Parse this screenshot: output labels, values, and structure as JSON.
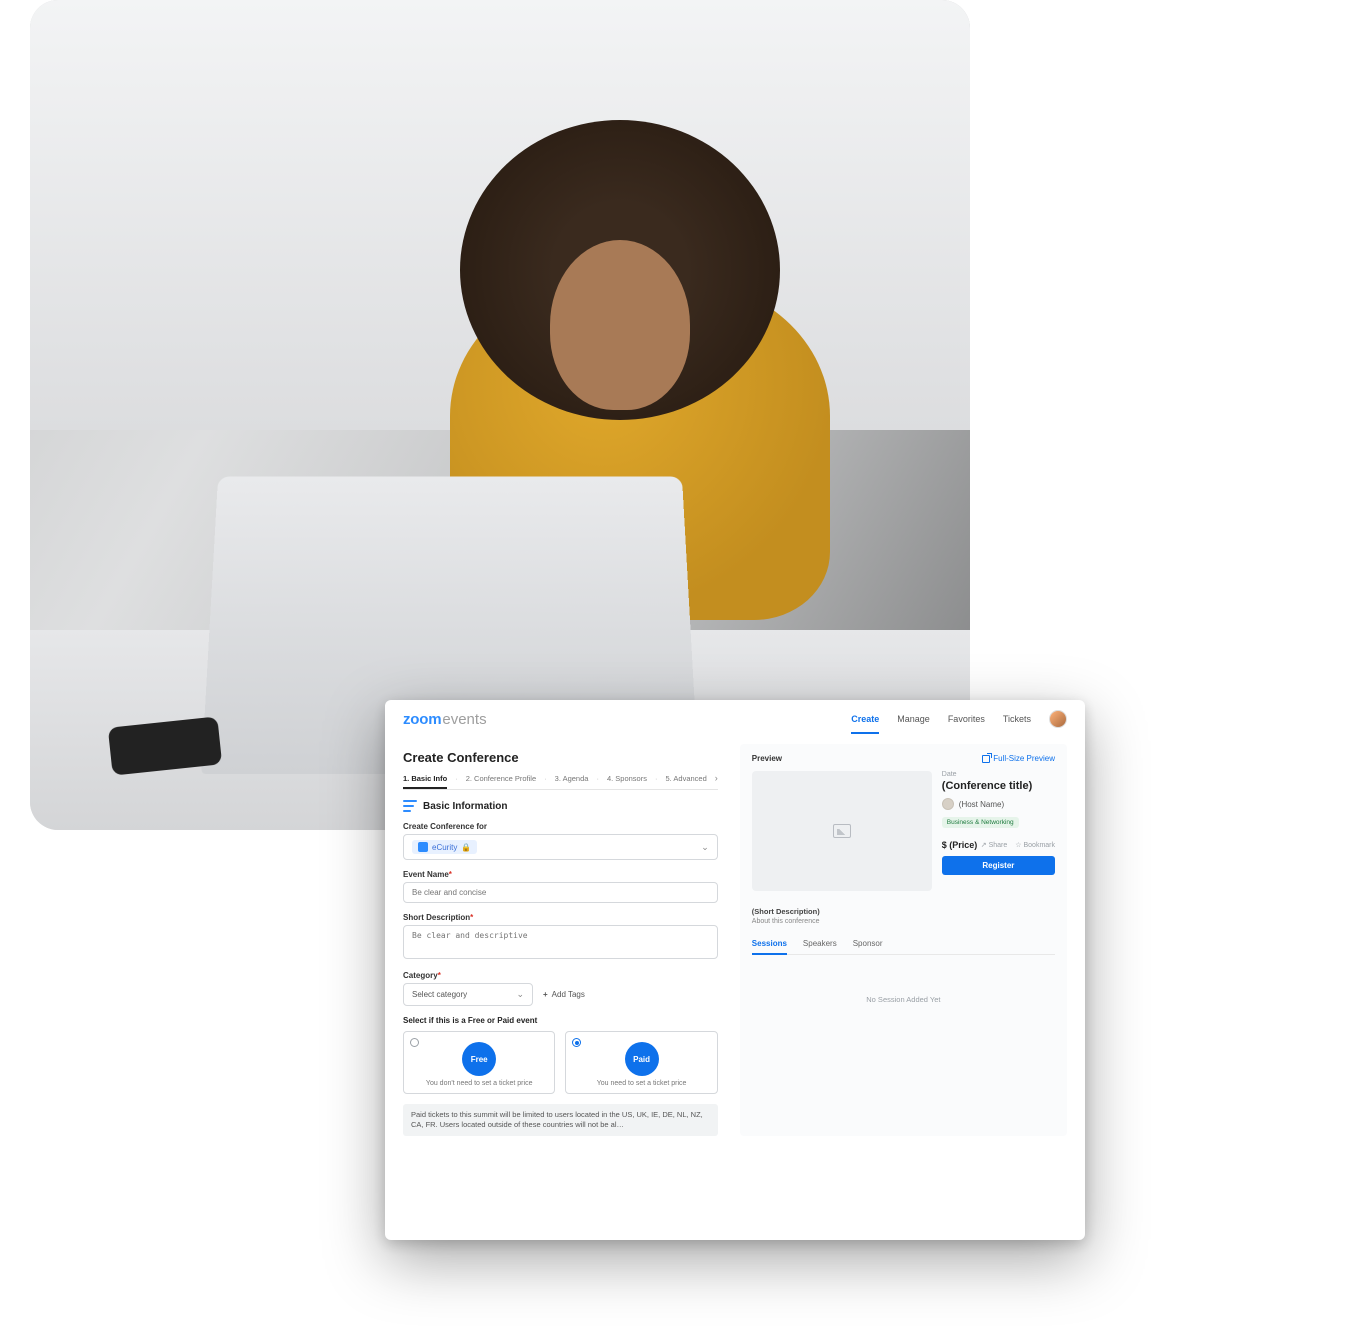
{
  "brand": {
    "primary": "zoom",
    "secondary": "events"
  },
  "nav": {
    "items": [
      "Create",
      "Manage",
      "Favorites",
      "Tickets"
    ],
    "active_index": 0
  },
  "page": {
    "title": "Create Conference",
    "steps": [
      "1. Basic Info",
      "2. Conference Profile",
      "3. Agenda",
      "4. Sponsors",
      "5. Advanced"
    ],
    "active_step": 0
  },
  "section": {
    "title": "Basic Information"
  },
  "form": {
    "hub_label": "Create Conference for",
    "hub_value": "eCurity",
    "event_name_label": "Event Name",
    "event_name_placeholder": "Be clear and concise",
    "short_desc_label": "Short Description",
    "short_desc_placeholder": "Be clear and descriptive",
    "category_label": "Category",
    "category_placeholder": "Select category",
    "add_tags_label": "Add Tags",
    "free_paid_label": "Select if this is a Free or Paid event",
    "free": {
      "pill": "Free",
      "caption": "You don't need to set a ticket price"
    },
    "paid": {
      "pill": "Paid",
      "caption": "You need to set a ticket price"
    },
    "selected_pricing": "paid",
    "notice": "Paid tickets to this summit will be limited to users located in the US, UK, IE, DE, NL, NZ, CA, FR. Users located outside of these countries will not be al…"
  },
  "preview": {
    "heading": "Preview",
    "full_size_label": "Full-Size Preview",
    "date_label": "Date",
    "conf_title_placeholder": "(Conference title)",
    "host_name": "(Host Name)",
    "category_badge": "Business & Networking",
    "price_label": "$ (Price)",
    "share_label": "Share",
    "bookmark_label": "Bookmark",
    "register_label": "Register",
    "short_desc_title": "(Short Description)",
    "short_desc_hint": "About this conference",
    "subtabs": [
      "Sessions",
      "Speakers",
      "Sponsor"
    ],
    "subtab_active": 0,
    "empty_state": "No Session Added Yet"
  }
}
